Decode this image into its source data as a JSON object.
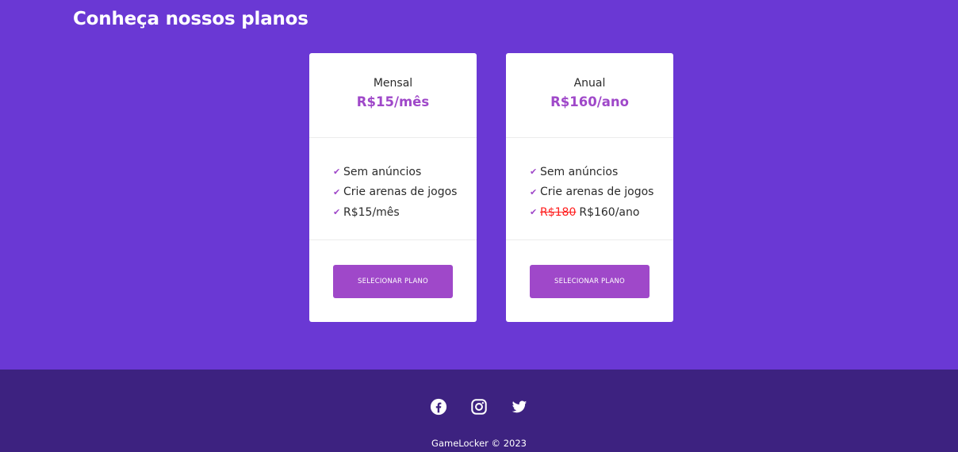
{
  "page": {
    "title": "Conheça nossos planos"
  },
  "plans": [
    {
      "name": "Mensal",
      "price": "R$15/mês",
      "features": [
        "Sem anúncios",
        "Crie arenas de jogos",
        "R$15/mês"
      ],
      "button": "SELECIONAR PLANO"
    },
    {
      "name": "Anual",
      "price": "R$160/ano",
      "features": [
        "Sem anúncios",
        "Crie arenas de jogos"
      ],
      "price_feature": {
        "old": "R$180",
        "new": "R$160/ano"
      },
      "button": "SELECIONAR PLANO"
    }
  ],
  "footer": {
    "socials": [
      "facebook-icon",
      "instagram-icon",
      "twitter-icon"
    ],
    "copyright": "GameLocker © 2023"
  },
  "colors": {
    "background": "#6a38d4",
    "accent": "#9f48c9",
    "footer": "#3d2280",
    "strike": "#ff1f1f"
  }
}
